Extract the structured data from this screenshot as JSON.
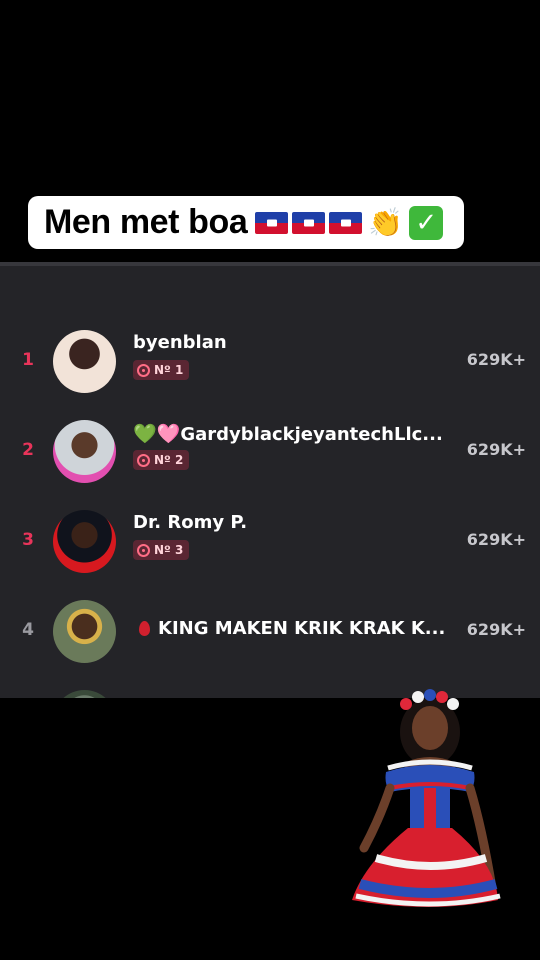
{
  "caption": {
    "text": "Men met boa",
    "emoji_icons": [
      "haiti-flag",
      "haiti-flag",
      "haiti-flag",
      "clapping-hands",
      "check-mark"
    ]
  },
  "leaderboard": {
    "rows": [
      {
        "rank": "1",
        "name": "byenblan",
        "badge": "Nº 1",
        "score": "629K+",
        "avatar": "user-avatar"
      },
      {
        "rank": "2",
        "name": "GardyblackjeyantechLlc...",
        "badge": "Nº 2",
        "score": "629K+",
        "avatar": "user-avatar",
        "prefix_icons": [
          "green-heart",
          "pink-heart"
        ]
      },
      {
        "rank": "3",
        "name": "Dr. Romy P.",
        "badge": "Nº 3",
        "score": "629K+",
        "avatar": "user-avatar"
      },
      {
        "rank": "4",
        "name": "KING MAKEN KRIK KRAK K...",
        "score": "629K+",
        "avatar": "user-avatar",
        "prefix_icons": [
          "blood-drop"
        ]
      }
    ]
  },
  "colors": {
    "panel_bg": "#242428",
    "rank_top3": "#e8345a",
    "rank_other": "#9a9aa0",
    "badge_bg": "#5a2633"
  }
}
